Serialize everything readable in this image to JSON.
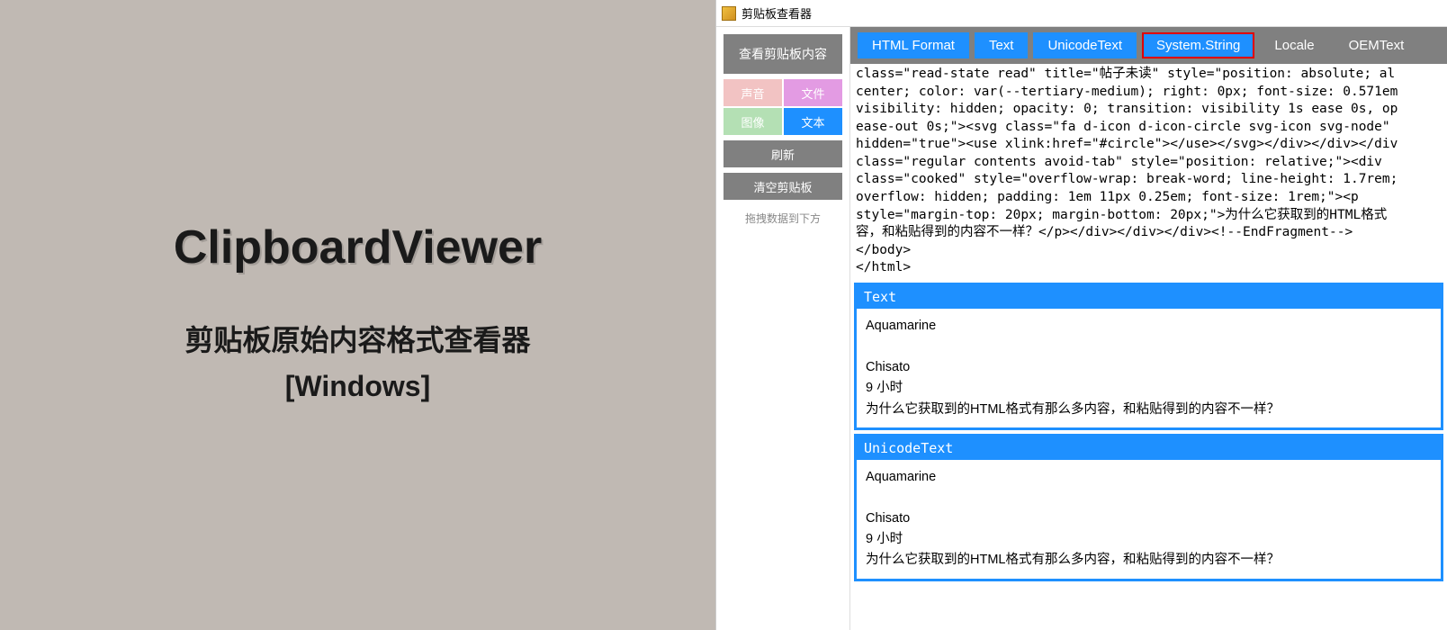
{
  "left": {
    "title": "ClipboardViewer",
    "subtitle_line1": "剪贴板原始内容格式查看器",
    "subtitle_line2": "[Windows]"
  },
  "window": {
    "title": "剪贴板查看器"
  },
  "sidebar": {
    "view_btn": "查看剪贴板内容",
    "types": {
      "sound": "声音",
      "file": "文件",
      "image": "图像",
      "text": "文本"
    },
    "refresh": "刷新",
    "clear": "清空剪贴板",
    "drag_hint": "拖拽数据到下方"
  },
  "tabs": [
    {
      "label": "HTML Format",
      "active": true,
      "selected": false
    },
    {
      "label": "Text",
      "active": true,
      "selected": false
    },
    {
      "label": "UnicodeText",
      "active": true,
      "selected": false
    },
    {
      "label": "System.String",
      "active": true,
      "selected": true
    },
    {
      "label": "Locale",
      "active": false,
      "selected": false
    },
    {
      "label": "OEMText",
      "active": false,
      "selected": false
    }
  ],
  "html_code": "class=\"read-state read\" title=\"帖子未读\" style=\"position: absolute; al\ncenter; color: var(--tertiary-medium); right: 0px; font-size: 0.571em\nvisibility: hidden; opacity: 0; transition: visibility 1s ease 0s, op\nease-out 0s;\"><svg class=\"fa d-icon d-icon-circle svg-icon svg-node\" \nhidden=\"true\"><use xlink:href=\"#circle\"></use></svg></div></div></div\nclass=\"regular contents avoid-tab\" style=\"position: relative;\"><div \nclass=\"cooked\" style=\"overflow-wrap: break-word; line-height: 1.7rem;\noverflow: hidden; padding: 1em 11px 0.25em; font-size: 1rem;\"><p \nstyle=\"margin-top: 20px; margin-bottom: 20px;\">为什么它获取到的HTML格式\n容，和粘贴得到的内容不一样？</p></div></div></div><!--EndFragment-->\n</body>\n</html>",
  "sections": [
    {
      "header": "Text",
      "body": "Aquamarine\n\nChisato\n9 小时\n为什么它获取到的HTML格式有那么多内容，和粘贴得到的内容不一样？"
    },
    {
      "header": "UnicodeText",
      "body": "Aquamarine\n\nChisato\n9 小时\n为什么它获取到的HTML格式有那么多内容，和粘贴得到的内容不一样？"
    }
  ]
}
